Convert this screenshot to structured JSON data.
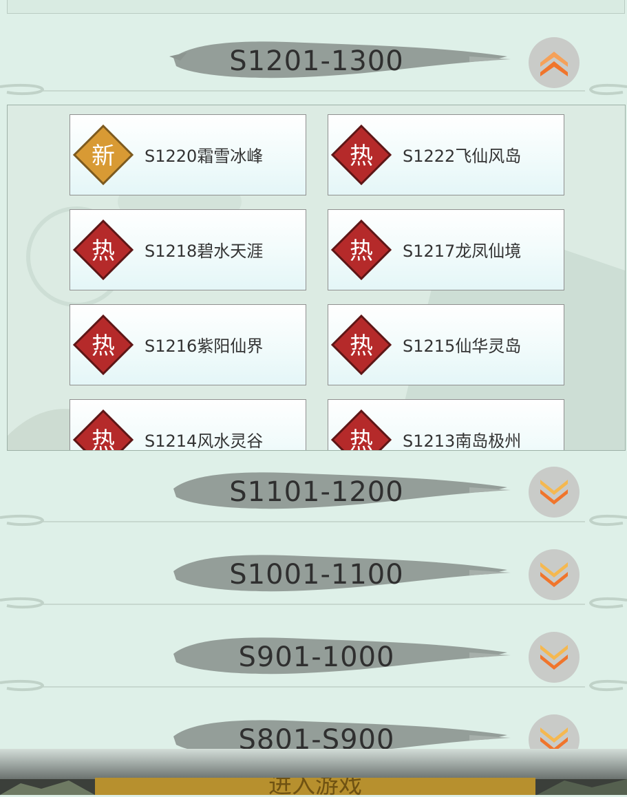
{
  "groups": [
    {
      "label": "S1201-1300",
      "expanded": true
    },
    {
      "label": "S1101-1200",
      "expanded": false
    },
    {
      "label": "S1001-1100",
      "expanded": false
    },
    {
      "label": "S901-1000",
      "expanded": false
    },
    {
      "label": "S801-S900",
      "expanded": false
    }
  ],
  "servers": [
    {
      "name": "S1220霜雪冰峰",
      "badge": "新",
      "status": "new"
    },
    {
      "name": "S1222飞仙风岛",
      "badge": "热",
      "status": "hot"
    },
    {
      "name": "S1218碧水天涯",
      "badge": "热",
      "status": "hot"
    },
    {
      "name": "S1217龙凤仙境",
      "badge": "热",
      "status": "hot"
    },
    {
      "name": "S1216紫阳仙界",
      "badge": "热",
      "status": "hot"
    },
    {
      "name": "S1215仙华灵岛",
      "badge": "热",
      "status": "hot"
    },
    {
      "name": "S1214风水灵谷",
      "badge": "热",
      "status": "hot"
    },
    {
      "name": "S1213南岛极州",
      "badge": "热",
      "status": "hot"
    }
  ],
  "footer": {
    "enter_label": "进入游戏"
  },
  "colors": {
    "hot": "#b52a2a",
    "new": "#d89a34",
    "background": "#def0e8",
    "toggle": "#f08a2e"
  },
  "icons": {
    "collapse": "chevron-up-icon",
    "expand": "chevron-down-icon"
  }
}
